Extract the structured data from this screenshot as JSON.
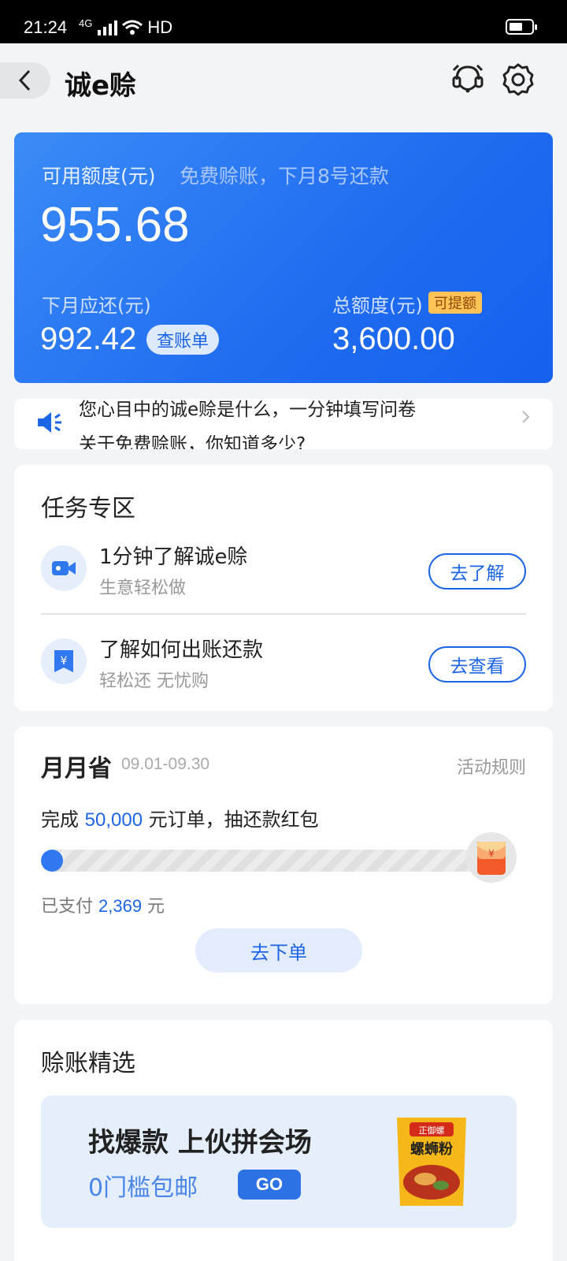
{
  "status_bar": {
    "time": "21:24",
    "network": "4G",
    "hd": "HD"
  },
  "nav": {
    "title": "诚e赊"
  },
  "credit": {
    "available_label": "可用额度(元)",
    "hint": "免费赊账，下月8号还款",
    "available_amount": "955.68",
    "next_due_label": "下月应还(元)",
    "next_due_amount": "992.42",
    "bill_button": "查账单",
    "total_label": "总额度(元)",
    "raise_badge": "可提额",
    "total_amount": "3,600.00"
  },
  "notice": {
    "line1": "您心目中的诚e赊是什么，一分钟填写问卷",
    "line2": "关于免费赊账，你知道多少?"
  },
  "tasks": {
    "title": "任务专区",
    "items": [
      {
        "title": "1分钟了解诚e赊",
        "subtitle": "生意轻松做",
        "button": "去了解",
        "icon": "video-icon"
      },
      {
        "title": "了解如何出账还款",
        "subtitle": "轻松还 无忧购",
        "button": "去查看",
        "icon": "yuan-bill-icon"
      }
    ]
  },
  "monthly": {
    "title": "月月省",
    "date_range": "09.01-09.30",
    "rules": "活动规则",
    "desc_prefix": "完成 ",
    "target": "50,000",
    "desc_suffix": " 元订单，抽还款红包",
    "paid_prefix": "已支付 ",
    "paid_amount": "2,369",
    "paid_suffix": " 元",
    "progress": 0.05,
    "order_button": "去下单"
  },
  "featured": {
    "title": "赊账精选",
    "banner_title": "找爆款 上伙拼会场",
    "banner_sub": "0门槛包邮",
    "go": "GO",
    "product_brand": "正御螺",
    "product_name": "螺蛳粉"
  },
  "colors": {
    "primary": "#1c65e6",
    "card_gradient_start": "#3b8bf7",
    "card_gradient_end": "#1561ee",
    "badge": "#ffc257"
  }
}
